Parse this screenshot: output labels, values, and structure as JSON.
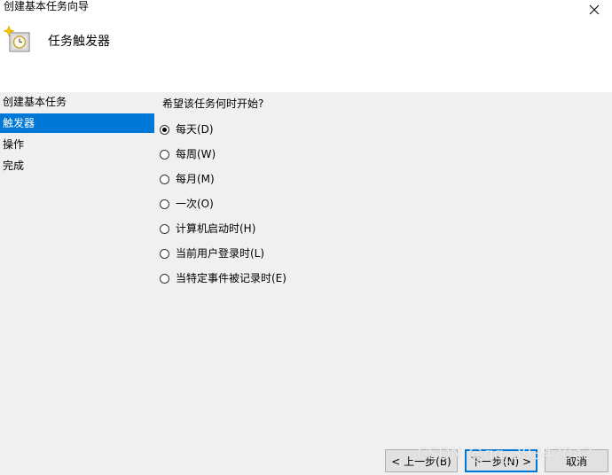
{
  "window": {
    "title": "创建基本任务向导"
  },
  "header": {
    "title": "任务触发器",
    "icon": "task-scheduler-clock-icon"
  },
  "nav": {
    "items": [
      {
        "label": "创建基本任务",
        "selected": false
      },
      {
        "label": "触发器",
        "selected": true
      },
      {
        "label": "操作",
        "selected": false
      },
      {
        "label": "完成",
        "selected": false
      }
    ]
  },
  "content": {
    "question": "希望该任务何时开始?",
    "options": [
      {
        "label": "每天(D)",
        "checked": true
      },
      {
        "label": "每周(W)",
        "checked": false
      },
      {
        "label": "每月(M)",
        "checked": false
      },
      {
        "label": "一次(O)",
        "checked": false
      },
      {
        "label": "计算机启动时(H)",
        "checked": false
      },
      {
        "label": "当前用户登录时(L)",
        "checked": false
      },
      {
        "label": "当特定事件被记录时(E)",
        "checked": false
      }
    ]
  },
  "buttons": {
    "back": "< 上一步(B)",
    "next": "下一步(N) >",
    "cancel": "取消"
  },
  "watermark": "CSDN @qq_39347043",
  "colors": {
    "selection": "#0078d7",
    "background": "#f0f0f0",
    "header": "#ffffff"
  }
}
